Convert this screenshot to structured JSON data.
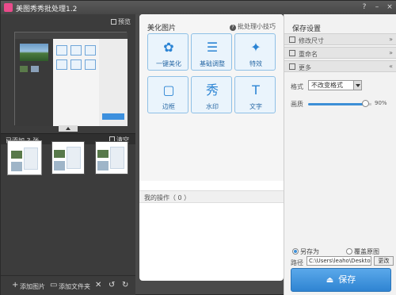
{
  "window": {
    "title": "美图秀秀批处理1.2",
    "controls": [
      "?",
      "–",
      "×"
    ]
  },
  "left": {
    "preview_label": "预览",
    "added_label": "已添加 3 张",
    "clear_label": "清空",
    "bottom": {
      "add_image": "添加图片",
      "add_folder": "添加文件夹"
    }
  },
  "middle": {
    "title": "美化图片",
    "help": "批处理小技巧",
    "tools": [
      {
        "label": "一键美化",
        "icon": "flower-icon",
        "glyph": "✿"
      },
      {
        "label": "基础调整",
        "icon": "sliders-icon",
        "glyph": "☰"
      },
      {
        "label": "特效",
        "icon": "magic-wand-icon",
        "glyph": "✦"
      },
      {
        "label": "边框",
        "icon": "frame-icon",
        "glyph": "▢"
      },
      {
        "label": "水印",
        "icon": "watermark-icon",
        "glyph": "秀"
      },
      {
        "label": "文字",
        "icon": "text-icon",
        "glyph": "T"
      }
    ],
    "ops_label": "我的操作（ 0 ）"
  },
  "right": {
    "title": "保存设置",
    "sections": [
      "修改尺寸",
      "重命名",
      "更多"
    ],
    "format_label": "格式",
    "format_value": "不改变格式",
    "quality_label": "画质",
    "quality_value": "90%",
    "quality_fraction": 0.9,
    "radio_save_as": "另存为",
    "radio_overwrite": "覆盖原图",
    "radio_selected": "save_as",
    "path_label": "路径",
    "path_value": "C:\\Users\\leaho\\Desktop",
    "change_label": "更改",
    "save_label": "保存"
  },
  "colors": {
    "accent": "#3d8fd6",
    "tool_border": "#8fc0e6",
    "dark_panel": "#3c3c3c"
  }
}
